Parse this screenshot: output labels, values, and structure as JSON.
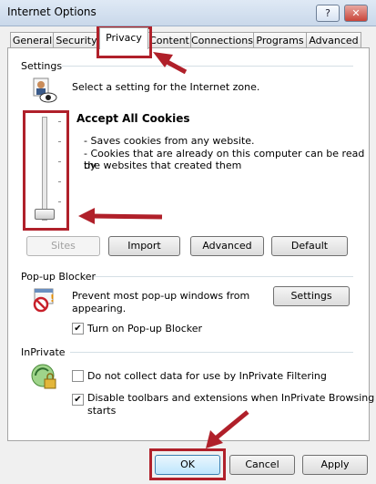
{
  "window": {
    "title": "Internet Options",
    "help_label": "?",
    "close_label": "✕"
  },
  "tabs": [
    {
      "label": "General"
    },
    {
      "label": "Security"
    },
    {
      "label": "Privacy"
    },
    {
      "label": "Content"
    },
    {
      "label": "Connections"
    },
    {
      "label": "Programs"
    },
    {
      "label": "Advanced"
    }
  ],
  "settings": {
    "group_label": "Settings",
    "description": "Select a setting for the Internet zone.",
    "level_title": "Accept All Cookies",
    "bullet1": "- Saves cookies from any website.",
    "bullet2": "- Cookies that are already on this computer can be read by",
    "bullet3": "the websites that created them",
    "slider_level": 0,
    "buttons": {
      "sites": "Sites",
      "import": "Import",
      "advanced": "Advanced",
      "default": "Default"
    }
  },
  "popup": {
    "group_label": "Pop-up Blocker",
    "line1": "Prevent most pop-up windows from",
    "line2": "appearing.",
    "settings_button": "Settings",
    "checkbox_label": "Turn on Pop-up Blocker",
    "checked": true
  },
  "inprivate": {
    "group_label": "InPrivate",
    "filter_label": "Do not collect data for use by InPrivate Filtering",
    "filter_checked": false,
    "disable_label_1": "Disable toolbars and extensions when InPrivate Browsing",
    "disable_label_2": "starts",
    "disable_checked": true
  },
  "footer": {
    "ok": "OK",
    "cancel": "Cancel",
    "apply": "Apply"
  },
  "annotation_color": "#b0202a"
}
